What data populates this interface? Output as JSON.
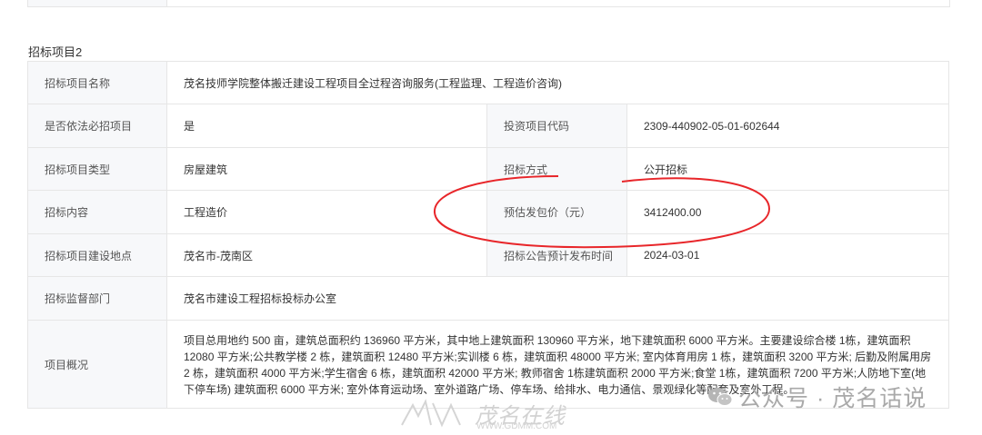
{
  "section": {
    "title": "招标项目2"
  },
  "rows": {
    "name": {
      "label": "招标项目名称",
      "value": "茂名技师学院整体搬迁建设工程项目全过程咨询服务(工程监理、工程造价咨询)"
    },
    "required": {
      "label": "是否依法必招项目",
      "value": "是",
      "label2": "投资项目代码",
      "value2": "2309-440902-05-01-602644"
    },
    "type": {
      "label": "招标项目类型",
      "value": "房屋建筑",
      "label2": "招标方式",
      "value2": "公开招标"
    },
    "content": {
      "label": "招标内容",
      "value": "工程造价",
      "label2": "预估发包价（元）",
      "value2": "3412400.00"
    },
    "location": {
      "label": "招标项目建设地点",
      "value": "茂名市-茂南区",
      "label2": "招标公告预计发布时间",
      "value2": "2024-03-01"
    },
    "supervisor": {
      "label": "招标监督部门",
      "value": "茂名市建设工程招标投标办公室"
    },
    "overview": {
      "label": "项目概况",
      "value": "项目总用地约 500 亩，建筑总面积约 136960 平方米，其中地上建筑面积 130960 平方米，地下建筑面积 6000 平方米。主要建设综合楼 1栋，建筑面积 12080 平方米;公共教学楼 2 栋，建筑面积 12480 平方米;实训楼 6 栋，建筑面积 48000 平方米; 室内体育用房 1 栋，建筑面积 3200 平方米; 后勤及附属用房 2 栋，建筑面积 4000 平方米;学生宿舍 6 栋，建筑面积 42000 平方米; 教师宿舍 1栋建筑面积 2000 平方米;食堂 1栋，建筑面积 7200 平方米;人防地下室(地下停车场) 建筑面积 6000 平方米; 室外体育运动场、室外道路广场、停车场、给排水、电力通信、景观绿化等配套及室外工程。"
    }
  },
  "watermarks": {
    "site_name": "茂名在线",
    "site_url": "WWW.GDMM.COM",
    "account": "公众号 · 茂名话说"
  },
  "annotation_color": "#e8262a"
}
